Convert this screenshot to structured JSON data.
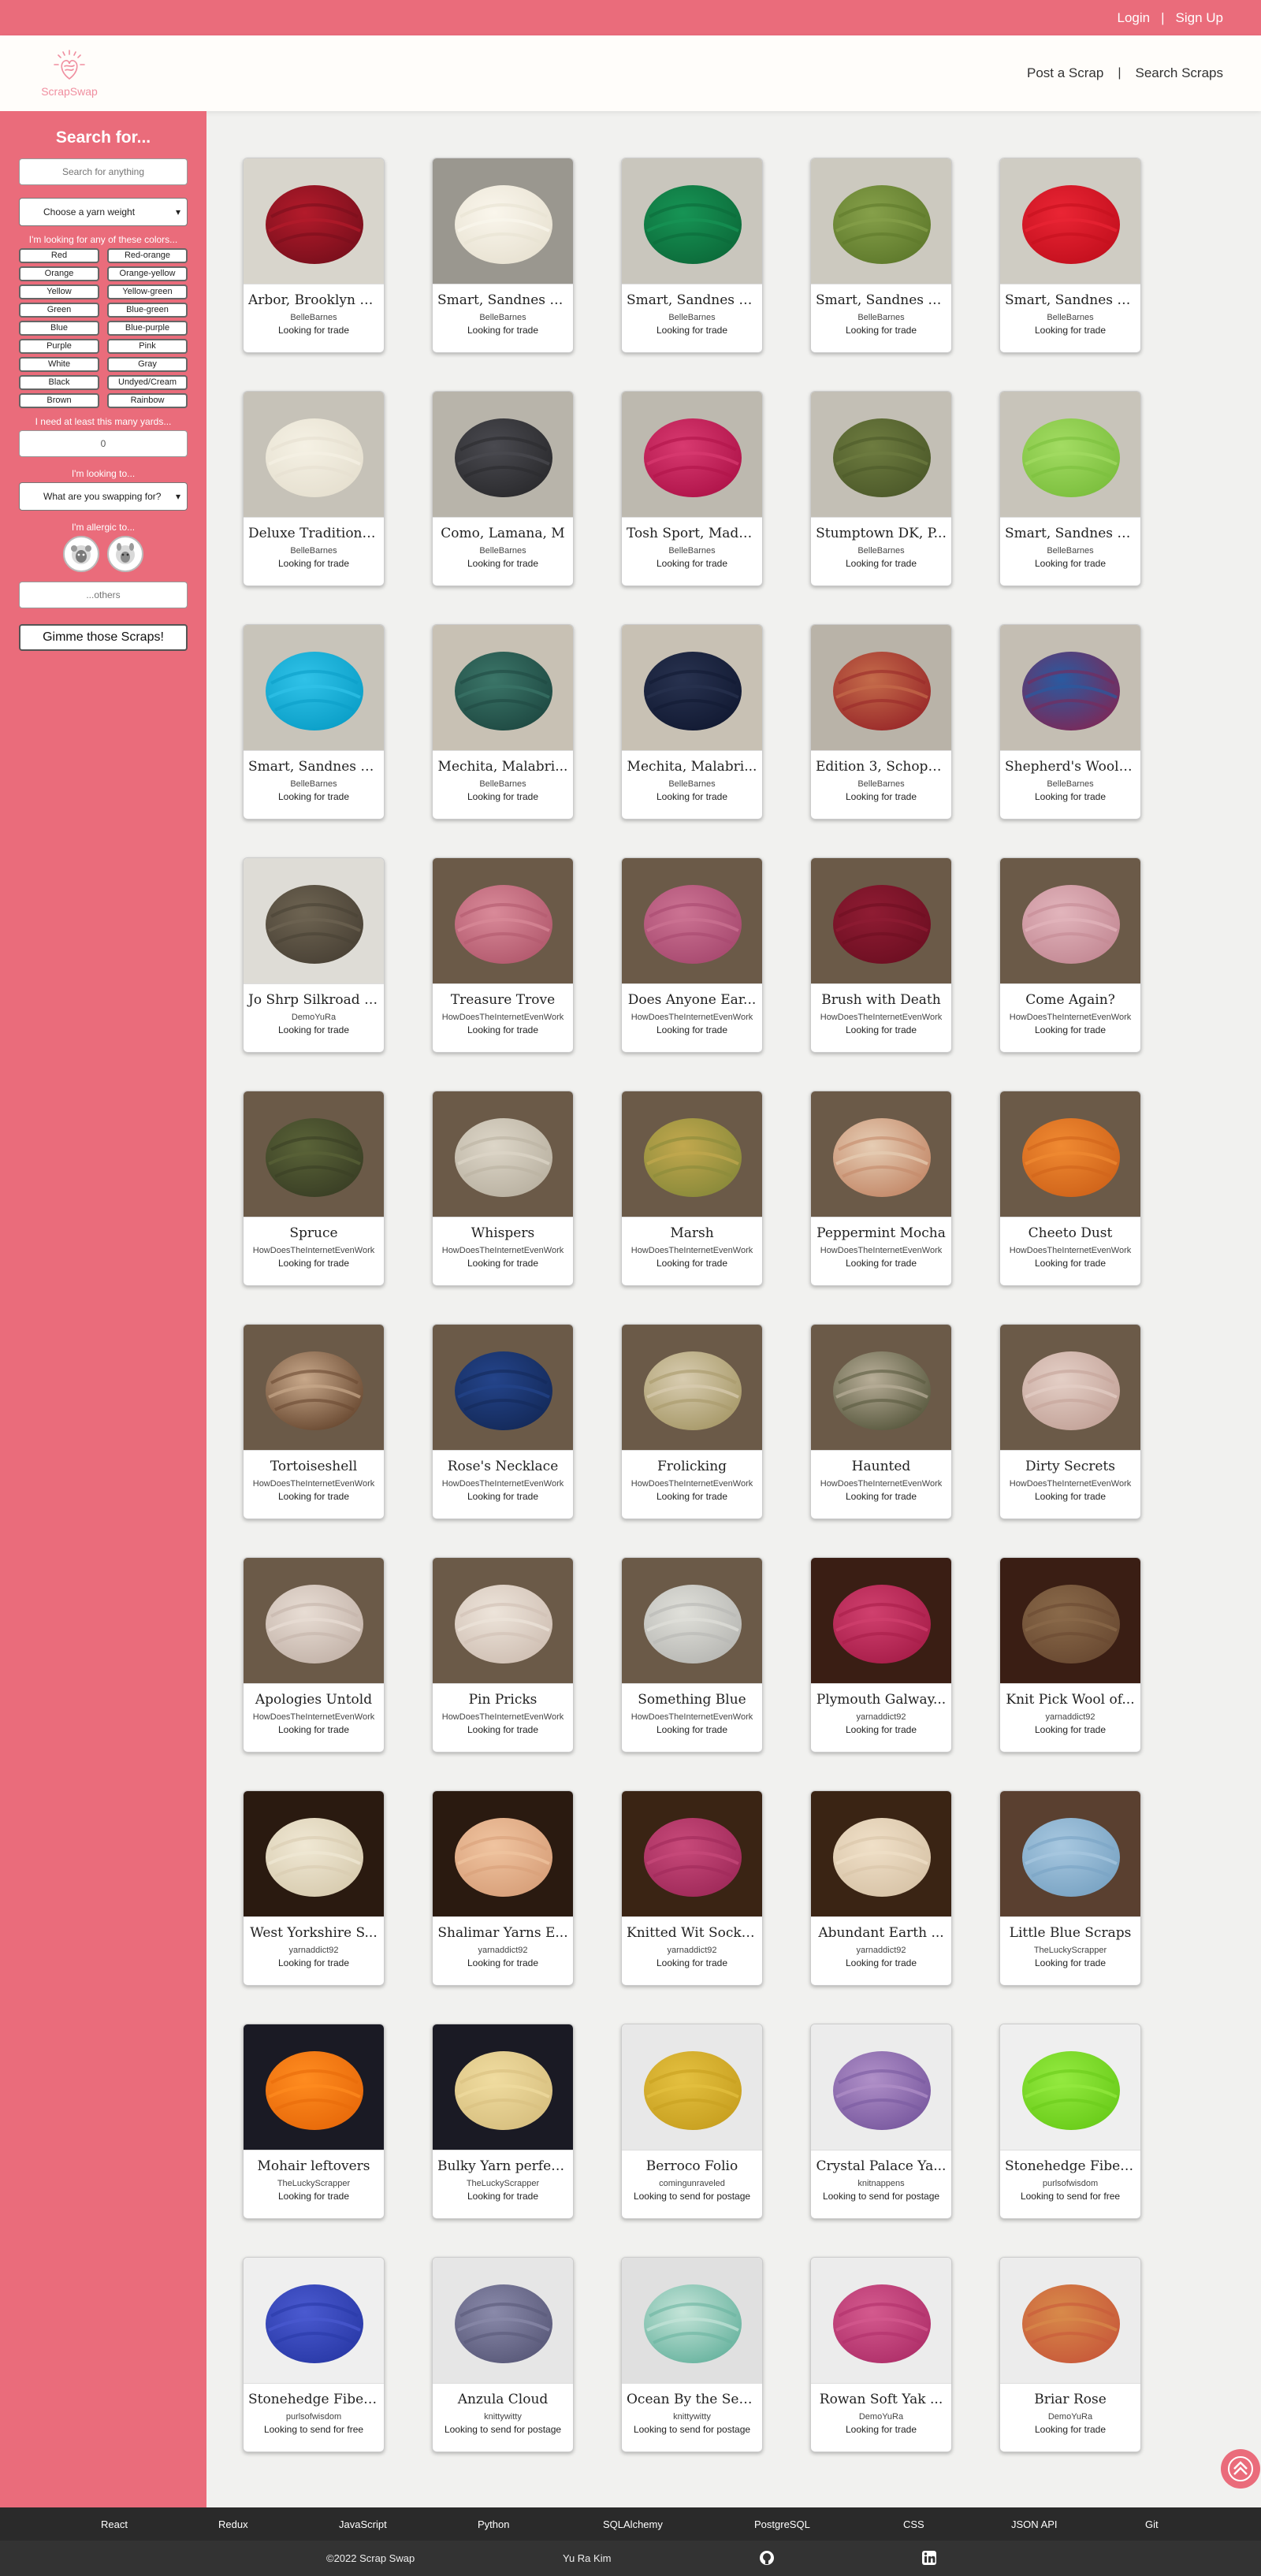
{
  "topbar": {
    "login": "Login",
    "separator": "|",
    "signup": "Sign Up"
  },
  "navbar": {
    "logo_text": "ScrapSwap",
    "post": "Post a Scrap",
    "separator": "|",
    "search": "Search Scraps"
  },
  "sidebar": {
    "title": "Search for...",
    "search_placeholder": "Search for anything",
    "weight_select": "Choose a yarn weight",
    "colors_label": "I'm looking for any of these colors...",
    "colors": [
      "Red",
      "Red-orange",
      "Orange",
      "Orange-yellow",
      "Yellow",
      "Yellow-green",
      "Green",
      "Blue-green",
      "Blue",
      "Blue-purple",
      "Purple",
      "Pink",
      "White",
      "Gray",
      "Black",
      "Undyed/Cream",
      "Brown",
      "Rainbow"
    ],
    "yards_label": "I need at least this many yards...",
    "yards_value": "0",
    "looking_label": "I'm looking to...",
    "looking_select": "What are you swapping for?",
    "allergic_label": "I'm allergic to...",
    "others_placeholder": "...others",
    "submit": "Gimme those Scraps!"
  },
  "listings": [
    {
      "title": "Arbor, Brooklyn T...",
      "user": "BelleBarnes",
      "status": "Looking for trade",
      "c1": "#7a0f1c",
      "c2": "#b31b2b",
      "bg": "#d8d5cc"
    },
    {
      "title": "Smart, Sandnes G...",
      "user": "BelleBarnes",
      "status": "Looking for trade",
      "c1": "#e8e2d2",
      "c2": "#faf6ec",
      "bg": "#9a978f"
    },
    {
      "title": "Smart, Sandnes G...",
      "user": "BelleBarnes",
      "status": "Looking for trade",
      "c1": "#0c6b3a",
      "c2": "#179455",
      "bg": "#c9c6bd"
    },
    {
      "title": "Smart, Sandnes G...",
      "user": "BelleBarnes",
      "status": "Looking for trade",
      "c1": "#5f7a2c",
      "c2": "#86a04a",
      "bg": "#ccc9bf"
    },
    {
      "title": "Smart, Sandnes G...",
      "user": "BelleBarnes",
      "status": "Looking for trade",
      "c1": "#c4101e",
      "c2": "#ea2534",
      "bg": "#cfccc3"
    },
    {
      "title": "Deluxe Tradition, ...",
      "user": "BelleBarnes",
      "status": "Looking for trade",
      "c1": "#e6e0d0",
      "c2": "#f5f1e4",
      "bg": "#c6c2b8"
    },
    {
      "title": "Como, Lamana, M",
      "user": "BelleBarnes",
      "status": "Looking for trade",
      "c1": "#2b2b2e",
      "c2": "#4a4a50",
      "bg": "#b8b4aa"
    },
    {
      "title": "Tosh Sport, MadT...",
      "user": "BelleBarnes",
      "status": "Looking for trade",
      "c1": "#b0144a",
      "c2": "#d83a70",
      "bg": "#bdb9af"
    },
    {
      "title": "Stumptown DK, P...",
      "user": "BelleBarnes",
      "status": "Looking for trade",
      "c1": "#4d5a2a",
      "c2": "#6e7c40",
      "bg": "#c3bfb5"
    },
    {
      "title": "Smart, Sandnes G...",
      "user": "BelleBarnes",
      "status": "Looking for trade",
      "c1": "#7cbf3e",
      "c2": "#a3dc63",
      "bg": "#c8c4ba"
    },
    {
      "title": "Smart, Sandnes G...",
      "user": "BelleBarnes",
      "status": "Looking for trade",
      "c1": "#0b9fc8",
      "c2": "#30c2e8",
      "bg": "#c8c4ba"
    },
    {
      "title": "Mechita, Malabri...",
      "user": "BelleBarnes",
      "status": "Looking for trade",
      "c1": "#1f4a43",
      "c2": "#3b7568",
      "bg": "#c8c1b4"
    },
    {
      "title": "Mechita, Malabri...",
      "user": "BelleBarnes",
      "status": "Looking for trade",
      "c1": "#121a33",
      "c2": "#28324f",
      "bg": "#c8c1b4"
    },
    {
      "title": "Edition 3, Schoppe...",
      "user": "BelleBarnes",
      "status": "Looking for trade",
      "c1": "#9a2a2a",
      "c2": "#c46b4a",
      "bg": "#b9b3a8"
    },
    {
      "title": "Shepherd's Wool ...",
      "user": "BelleBarnes",
      "status": "Looking for trade",
      "c1": "#7a2a5a",
      "c2": "#2a5aa0",
      "bg": "#c4beb3"
    },
    {
      "title": "Jo Shrp Silkroad A...",
      "user": "DemoYuRa",
      "status": "Looking for trade",
      "c1": "#4a4236",
      "c2": "#6e6452",
      "bg": "#dedcd6"
    },
    {
      "title": "Treasure Trove",
      "user": "HowDoesTheInternetEvenWork",
      "status": "Looking for trade",
      "c1": "#b35a6e",
      "c2": "#d98a99",
      "bg": "#6b5a48"
    },
    {
      "title": "Does Anyone Ear...",
      "user": "HowDoesTheInternetEvenWork",
      "status": "Looking for trade",
      "c1": "#a84a70",
      "c2": "#cc7393",
      "bg": "#6b5a48"
    },
    {
      "title": "Brush with Death",
      "user": "HowDoesTheInternetEvenWork",
      "status": "Looking for trade",
      "c1": "#6e0f22",
      "c2": "#8f1c33",
      "bg": "#6b5a48"
    },
    {
      "title": "Come Again?",
      "user": "HowDoesTheInternetEvenWork",
      "status": "Looking for trade",
      "c1": "#c48a95",
      "c2": "#e2b5bc",
      "bg": "#6b5a48"
    },
    {
      "title": "Spruce",
      "user": "HowDoesTheInternetEvenWork",
      "status": "Looking for trade",
      "c1": "#3a3f25",
      "c2": "#5a6338",
      "bg": "#6b5a48"
    },
    {
      "title": "Whispers",
      "user": "HowDoesTheInternetEvenWork",
      "status": "Looking for trade",
      "c1": "#bab2a2",
      "c2": "#ddd6c8",
      "bg": "#6b5a48"
    },
    {
      "title": "Marsh",
      "user": "HowDoesTheInternetEvenWork",
      "status": "Looking for trade",
      "c1": "#8a8a3a",
      "c2": "#c2a84e",
      "bg": "#6b5a48"
    },
    {
      "title": "Peppermint Mocha",
      "user": "HowDoesTheInternetEvenWork",
      "status": "Looking for trade",
      "c1": "#c48a6a",
      "c2": "#e6cdb4",
      "bg": "#6b5a48"
    },
    {
      "title": "Cheeto Dust",
      "user": "HowDoesTheInternetEvenWork",
      "status": "Looking for trade",
      "c1": "#d0641a",
      "c2": "#f08a32",
      "bg": "#6b5a48"
    },
    {
      "title": "Tortoiseshell",
      "user": "HowDoesTheInternetEvenWork",
      "status": "Looking for trade",
      "c1": "#6a4a32",
      "c2": "#c8a88a",
      "bg": "#6b5a48"
    },
    {
      "title": "Rose's Necklace",
      "user": "HowDoesTheInternetEvenWork",
      "status": "Looking for trade",
      "c1": "#142a5a",
      "c2": "#24448a",
      "bg": "#6b5a48"
    },
    {
      "title": "Frolicking",
      "user": "HowDoesTheInternetEvenWork",
      "status": "Looking for trade",
      "c1": "#a89a6a",
      "c2": "#d8ccb0",
      "bg": "#6b5a48"
    },
    {
      "title": "Haunted",
      "user": "HowDoesTheInternetEvenWork",
      "status": "Looking for trade",
      "c1": "#5a5a40",
      "c2": "#b8ae98",
      "bg": "#6b5a48"
    },
    {
      "title": "Dirty Secrets",
      "user": "HowDoesTheInternetEvenWork",
      "status": "Looking for trade",
      "c1": "#c4a49a",
      "c2": "#e4cfc6",
      "bg": "#6b5a48"
    },
    {
      "title": "Apologies Untold",
      "user": "HowDoesTheInternetEvenWork",
      "status": "Looking for trade",
      "c1": "#c4b4aa",
      "c2": "#e8ddd4",
      "bg": "#6b5a48"
    },
    {
      "title": "Pin Pricks",
      "user": "HowDoesTheInternetEvenWork",
      "status": "Looking for trade",
      "c1": "#d0c0b4",
      "c2": "#ede4da",
      "bg": "#6b5a48"
    },
    {
      "title": "Something Blue",
      "user": "HowDoesTheInternetEvenWork",
      "status": "Looking for trade",
      "c1": "#b8b8b4",
      "c2": "#e0e0da",
      "bg": "#6b5a48"
    },
    {
      "title": "Plymouth Galway...",
      "user": "yarnaddict92",
      "status": "Looking for trade",
      "c1": "#a81e4a",
      "c2": "#d0406e",
      "bg": "#3a1e14"
    },
    {
      "title": "Knit Pick Wool of...",
      "user": "yarnaddict92",
      "status": "Looking for trade",
      "c1": "#6a4a32",
      "c2": "#8a6a4a",
      "bg": "#3a1e14"
    },
    {
      "title": "West Yorkshire S...",
      "user": "yarnaddict92",
      "status": "Looking for trade",
      "c1": "#d8ccb0",
      "c2": "#f0e8d4",
      "bg": "#2a1a10"
    },
    {
      "title": "Shalimar Yarns E...",
      "user": "yarnaddict92",
      "status": "Looking for trade",
      "c1": "#d8a07a",
      "c2": "#f0c4a0",
      "bg": "#2a1a10"
    },
    {
      "title": "Knitted Wit Sock ...",
      "user": "yarnaddict92",
      "status": "Looking for trade",
      "c1": "#a02a5a",
      "c2": "#c84a7a",
      "bg": "#3a2414"
    },
    {
      "title": "Abundant Earth ...",
      "user": "yarnaddict92",
      "status": "Looking for trade",
      "c1": "#d8c4a8",
      "c2": "#f0e0c8",
      "bg": "#3a2414"
    },
    {
      "title": "Little Blue Scraps",
      "user": "TheLuckyScrapper",
      "status": "Looking for trade",
      "c1": "#7aa4c4",
      "c2": "#a8c8e0",
      "bg": "#5a4030"
    },
    {
      "title": "Mohair leftovers",
      "user": "TheLuckyScrapper",
      "status": "Looking for trade",
      "c1": "#e86a0a",
      "c2": "#ff8c20",
      "bg": "#1a1a24"
    },
    {
      "title": "Bulky Yarn perfec...",
      "user": "TheLuckyScrapper",
      "status": "Looking for trade",
      "c1": "#d8c080",
      "c2": "#f0dca0",
      "bg": "#1a1a24"
    },
    {
      "title": "Berroco Folio",
      "user": "comingunraveled",
      "status": "Looking to send for postage",
      "c1": "#c8a020",
      "c2": "#e4c040",
      "bg": "#e8e8e8"
    },
    {
      "title": "Crystal Palace Ya...",
      "user": "knitnappens",
      "status": "Looking to send for postage",
      "c1": "#7a5aa0",
      "c2": "#b090c8",
      "bg": "#ececec"
    },
    {
      "title": "Stonehedge Fiber ...",
      "user": "purlsofwisdom",
      "status": "Looking to send for free",
      "c1": "#6acc1a",
      "c2": "#94ea40",
      "bg": "#efefef"
    },
    {
      "title": "Stonehedge Fiber ...",
      "user": "purlsofwisdom",
      "status": "Looking to send for free",
      "c1": "#2a3aa8",
      "c2": "#4a5ad0",
      "bg": "#efefef"
    },
    {
      "title": "Anzula Cloud",
      "user": "knittywitty",
      "status": "Looking to send for postage",
      "c1": "#5a5a7a",
      "c2": "#8a8aaa",
      "bg": "#e6e6e6"
    },
    {
      "title": "Ocean By the Sea...",
      "user": "knittywitty",
      "status": "Looking to send for postage",
      "c1": "#6ab4a0",
      "c2": "#c4e4d8",
      "bg": "#e0e0e0"
    },
    {
      "title": "Rowan Soft Yak ...",
      "user": "DemoYuRa",
      "status": "Looking for trade",
      "c1": "#b0306a",
      "c2": "#d45a8e",
      "bg": "#ececec"
    },
    {
      "title": "Briar Rose",
      "user": "DemoYuRa",
      "status": "Looking for trade",
      "c1": "#c85a3a",
      "c2": "#d88a4a",
      "bg": "#ececec"
    }
  ],
  "footer": {
    "tech": [
      "React",
      "Redux",
      "JavaScript",
      "Python",
      "SQLAlchemy",
      "PostgreSQL",
      "CSS",
      "JSON API",
      "Git"
    ],
    "copyright": "©2022 Scrap Swap",
    "author": "Yu Ra Kim"
  },
  "icons": {
    "logo": "heart-yarn-icon",
    "allergy": [
      "sheep-icon",
      "alpaca-icon"
    ],
    "footer": [
      "github-icon",
      "linkedin-icon"
    ],
    "scroll": "chevron-up-icon"
  },
  "colors": {
    "accent": "#ea6c7b",
    "footer": "#2a2a2a"
  }
}
